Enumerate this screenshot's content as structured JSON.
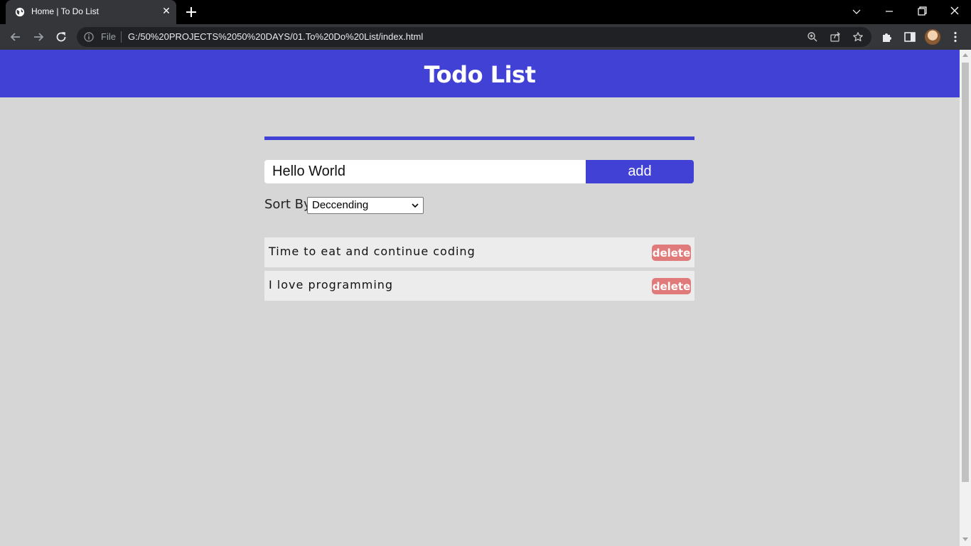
{
  "browser": {
    "tab_title": "Home | To Do List",
    "omnibox_file_label": "File",
    "url": "G:/50%20PROJECTS%2050%20DAYS/01.To%20Do%20List/index.html"
  },
  "header": {
    "title": "Todo List"
  },
  "form": {
    "input_value": "Hello World",
    "add_label": "add",
    "sort_label": "Sort By",
    "sort_selected": "Deccending"
  },
  "todos": [
    {
      "text": "Time to eat and continue coding",
      "delete_label": "delete"
    },
    {
      "text": "I love programming",
      "delete_label": "delete"
    }
  ],
  "colors": {
    "accent": "#4141d6",
    "background": "#d6d6d6",
    "item_background": "#ececec",
    "delete": "#e17b7b"
  },
  "icons": {
    "tab_favicon": "globe-icon",
    "tab_close": "close-icon",
    "new_tab": "plus-icon",
    "back": "back-arrow-icon",
    "forward": "forward-arrow-icon",
    "reload": "reload-icon",
    "site_info": "info-icon",
    "zoom": "zoom-icon",
    "share": "share-icon",
    "bookmark": "star-icon",
    "extensions": "puzzle-icon",
    "side_panel": "side-panel-icon",
    "menu": "kebab-menu-icon"
  }
}
